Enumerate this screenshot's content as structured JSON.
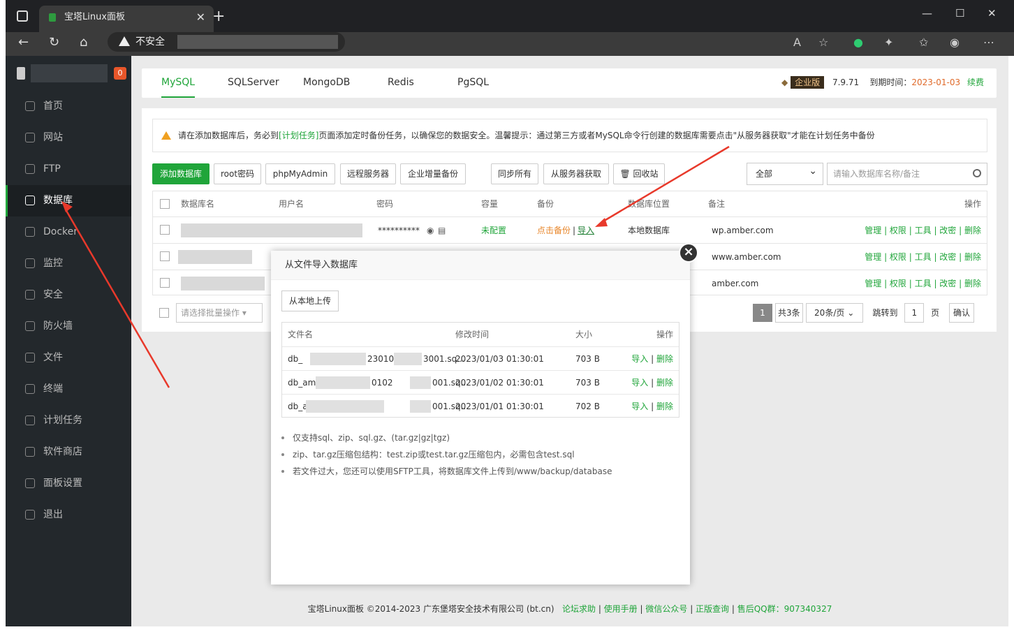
{
  "browser": {
    "tab_title": "宝塔Linux面板",
    "insecure_label": "不安全"
  },
  "sidebar": {
    "badge": "0",
    "items": [
      {
        "label": "首页",
        "icon": "home-icon"
      },
      {
        "label": "网站",
        "icon": "globe-icon"
      },
      {
        "label": "FTP",
        "icon": "ftp-icon"
      },
      {
        "label": "数据库",
        "icon": "database-icon",
        "active": true
      },
      {
        "label": "Docker",
        "icon": "docker-icon"
      },
      {
        "label": "监控",
        "icon": "monitor-icon"
      },
      {
        "label": "安全",
        "icon": "shield-icon"
      },
      {
        "label": "防火墙",
        "icon": "firewall-icon"
      },
      {
        "label": "文件",
        "icon": "folder-icon"
      },
      {
        "label": "终端",
        "icon": "terminal-icon"
      },
      {
        "label": "计划任务",
        "icon": "calendar-icon"
      },
      {
        "label": "软件商店",
        "icon": "grid-icon"
      },
      {
        "label": "面板设置",
        "icon": "gear-icon"
      },
      {
        "label": "退出",
        "icon": "logout-icon"
      }
    ]
  },
  "db_tabs": [
    "MySQL",
    "SQLServer",
    "MongoDB",
    "Redis",
    "PgSQL"
  ],
  "version": {
    "edition": "企业版",
    "number": "7.9.71",
    "expire_label": "到期时间：",
    "expire_date": "2023-01-03",
    "renew": "续费"
  },
  "notice": {
    "before": "请在添加数据库后，务必到",
    "link": "[计划任务]",
    "after": "页面添加定时备份任务，以确保您的数据安全。温馨提示：通过第三方或者MySQL命令行创建的数据库需要点击\"从服务器获取\"才能在计划任务中备份"
  },
  "toolbar": {
    "add_db": "添加数据库",
    "root_pwd": "root密码",
    "phpmyadmin": "phpMyAdmin",
    "remote": "远程服务器",
    "incremental": "企业增量备份",
    "sync_all": "同步所有",
    "from_server": "从服务器获取",
    "recycle": "回收站",
    "filter_value": "全部",
    "search_placeholder": "请输入数据库名称/备注"
  },
  "table": {
    "headers": {
      "name": "数据库名",
      "user": "用户名",
      "pwd": "密码",
      "cap": "容量",
      "backup": "备份",
      "loc": "数据库位置",
      "note": "备注",
      "op": "操作"
    },
    "rows": [
      {
        "password": "**********",
        "capacity": "未配置",
        "backup": "点击备份",
        "import": "导入",
        "location": "本地数据库",
        "note": "wp.amber.com"
      },
      {
        "note": "www.amber.com"
      },
      {
        "note": "amber.com"
      }
    ],
    "ops": {
      "manage": "管理",
      "perm": "权限",
      "tools": "工具",
      "chpwd": "改密",
      "del": "删除"
    },
    "batch_placeholder": "请选择批量操作"
  },
  "pager": {
    "page": "1",
    "total": "共3条",
    "per_page": "20条/页",
    "goto": "跳转到",
    "goto_value": "1",
    "page_unit": "页",
    "confirm": "确认"
  },
  "modal": {
    "title": "从文件导入数据库",
    "upload": "从本地上传",
    "headers": {
      "name": "文件名",
      "mtime": "修改时间",
      "size": "大小",
      "op": "操作"
    },
    "files": [
      {
        "name_a": "db_",
        "name_b": "23010",
        "name_c": "3001.sq...",
        "mtime": "2023/01/03 01:30:01",
        "size": "703 B"
      },
      {
        "name_a": "db_am",
        "name_b": "0102",
        "name_c": "001.sq...",
        "mtime": "2023/01/02 01:30:01",
        "size": "703 B"
      },
      {
        "name_a": "db_a",
        "name_b": "",
        "name_c": "001.sq...",
        "mtime": "2023/01/01 01:30:01",
        "size": "702 B"
      }
    ],
    "op_import": "导入",
    "op_delete": "删除",
    "tips": [
      "仅支持sql、zip、sql.gz、(tar.gz|gz|tgz)",
      "zip、tar.gz压缩包结构：test.zip或test.tar.gz压缩包内，必需包含test.sql",
      "若文件过大，您还可以使用SFTP工具，将数据库文件上传到/www/backup/database"
    ]
  },
  "footer": {
    "copyright": "宝塔Linux面板 ©2014-2023 广东堡塔安全技术有限公司 (bt.cn)",
    "links": [
      "论坛求助",
      "使用手册",
      "微信公众号",
      "正版查询",
      "售后QQ群：907340327"
    ]
  },
  "colors": {
    "accent": "#20a53a",
    "warning": "#e8862a",
    "arrow": "#e8392b"
  }
}
